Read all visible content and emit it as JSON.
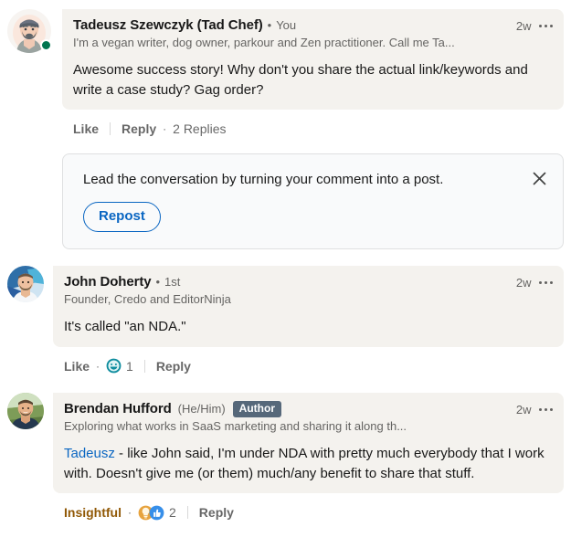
{
  "thread": {
    "comments": [
      {
        "id": "root-comment",
        "author": {
          "name": "Tadeusz Szewczyk (Tad Chef)",
          "relationship": "You",
          "headline": "I'm a vegan writer, dog owner, parkour and Zen practitioner. Call me Ta...",
          "avatar_name": "avatar-tadeusz-szewczyk",
          "presence": "online"
        },
        "timestamp": "2w",
        "menu_icon": "overflow-menu-icon",
        "text": "Awesome success story! Why don't you share the actual link/keywords and write a case study? Gag order?",
        "actions": {
          "like_label": "Like",
          "reply_label": "Reply",
          "replies_label": "2 Replies",
          "separator_dot": "·"
        }
      },
      {
        "id": "reply-john-doherty",
        "author": {
          "name": "John Doherty",
          "degree": "1st",
          "headline": "Founder, Credo and EditorNinja",
          "avatar_name": "avatar-john-doherty"
        },
        "timestamp": "2w",
        "menu_icon": "overflow-menu-icon",
        "text": "It's called \"an NDA.\"",
        "actions": {
          "like_label": "Like",
          "reply_label": "Reply",
          "separator_dot": "·",
          "reaction_count": "1",
          "reaction_icons": [
            "funny-reaction-icon"
          ]
        }
      },
      {
        "id": "reply-brendan-hufford",
        "author": {
          "name": "Brendan Hufford",
          "pronouns": "(He/Him)",
          "badge": "Author",
          "headline": "Exploring what works in SaaS marketing and sharing it along th...",
          "avatar_name": "avatar-brendan-hufford"
        },
        "timestamp": "2w",
        "menu_icon": "overflow-menu-icon",
        "text_mention": "Tadeusz",
        "text_rest": " - like John said, I'm under NDA with pretty much everybody that I work with. Doesn't give me (or them) much/any benefit to share that stuff.",
        "actions": {
          "like_label": "Insightful",
          "reply_label": "Reply",
          "separator_dot": "·",
          "reaction_count": "2",
          "reaction_icons": [
            "insightful-reaction-icon",
            "like-reaction-icon"
          ]
        }
      }
    ]
  },
  "repost_prompt": {
    "message": "Lead the conversation by turning your comment into a post.",
    "button_label": "Repost",
    "close_icon": "close-icon"
  },
  "colors": {
    "linkedin_blue": "#0a66c2",
    "bubble_background": "#f4f2ee",
    "insightful_text": "#915907",
    "author_badge_background": "#56687a",
    "presence_green": "#01754f",
    "page_background": "#ffffff"
  }
}
